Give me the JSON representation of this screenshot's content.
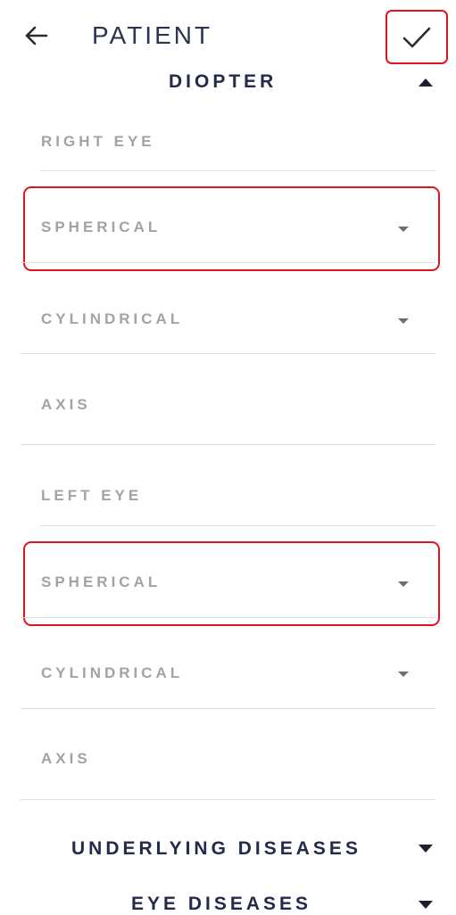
{
  "header": {
    "back_icon": "arrow-left-icon",
    "title": "PATIENT",
    "confirm_icon": "checkmark-icon",
    "highlight_color": "#e0141e"
  },
  "diopter": {
    "title": "DIOPTER",
    "expanded": true,
    "right_eye": {
      "label": "RIGHT EYE",
      "spherical_placeholder": "SPHERICAL",
      "cylindrical_placeholder": "CYLINDRICAL",
      "axis_placeholder": "AXIS"
    },
    "left_eye": {
      "label": "LEFT EYE",
      "spherical_placeholder": "SPHERICAL",
      "cylindrical_placeholder": "CYLINDRICAL",
      "axis_placeholder": "AXIS"
    }
  },
  "sections": {
    "underlying_diseases": "UNDERLYING DISEASES",
    "eye_diseases": "EYE DISEASES"
  },
  "colors": {
    "title_text": "#2b3350",
    "label_text": "#a3a3a3",
    "divider": "#dedede"
  }
}
